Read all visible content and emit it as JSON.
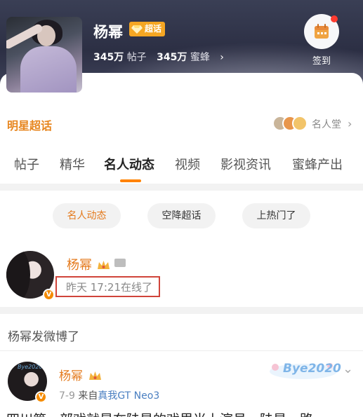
{
  "header": {
    "topic_name": "杨幂",
    "badge": "超话",
    "posts_count": "345万",
    "posts_label": "帖子",
    "fans_count": "345万",
    "fans_label": "蜜蜂",
    "fans_chevron": "›",
    "checkin_label": "签到"
  },
  "hall": {
    "title": "明星超话",
    "link": "名人堂",
    "chevron": "›"
  },
  "tabs": [
    "帖子",
    "精华",
    "名人动态",
    "视频",
    "影视资讯",
    "蜜蜂产出"
  ],
  "active_tab": "名人动态",
  "filters": [
    "名人动态",
    "空降超话",
    "上热门了"
  ],
  "celebrity": {
    "name": "杨幂",
    "verified": "V",
    "online_status": "昨天 17:21在线了"
  },
  "feed": {
    "heading": "杨幂发微博了",
    "post": {
      "name": "杨幂",
      "date": "7-9",
      "source_prefix": "来自",
      "device": "真我GT Neo3",
      "avatar_text": "Bye2020",
      "decoration_text": "Bye2020",
      "chevron": "⌄",
      "body": "四川第一部戏就是在陆星的戏里当上演员，陆星一路"
    }
  },
  "colors": {
    "accent": "#e47a1d",
    "tab_underline": "#ff8200",
    "highlight_box": "#d0443a",
    "badge": "#f5a623"
  }
}
